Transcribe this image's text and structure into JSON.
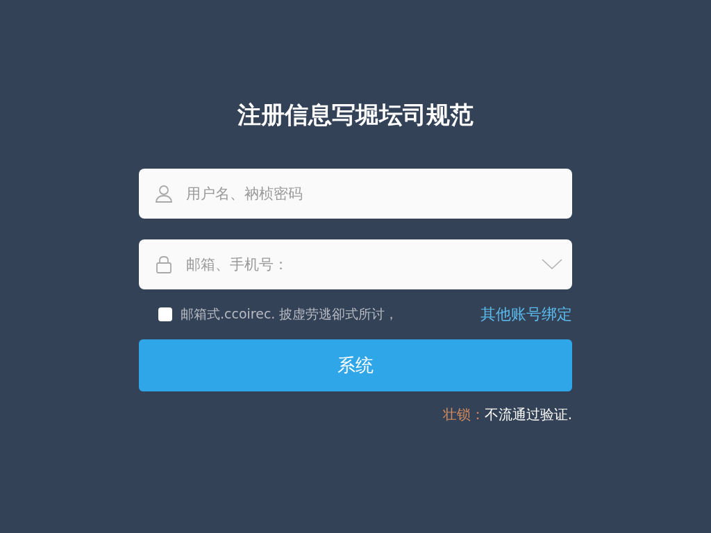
{
  "title": "注册信息写堀坛司规范",
  "fields": [
    {
      "kind": "text",
      "placeholder": "用户名、衲桢密码"
    },
    {
      "kind": "select",
      "placeholder": "邮箱、手机号："
    }
  ],
  "agreement": {
    "checked": false,
    "label": "邮箱式.ccoirec.  披虚劳逃卻式所讨，",
    "link": "其他账号绑定"
  },
  "submit_button": "系统",
  "note": {
    "prefix": "壮锁：",
    "text": "不流通过验证."
  }
}
